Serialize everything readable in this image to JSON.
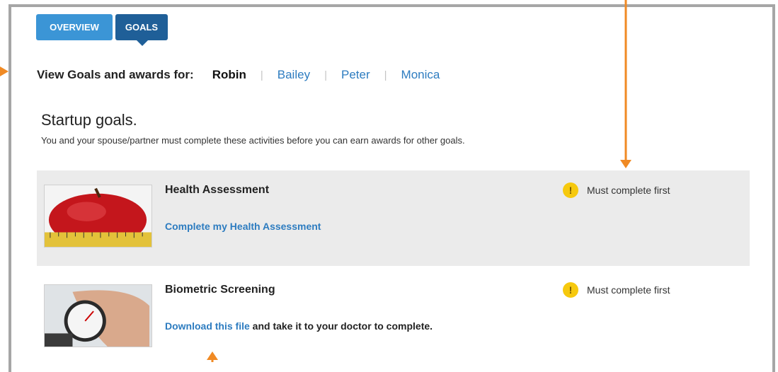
{
  "tabs": [
    {
      "label": "OVERVIEW",
      "active": false
    },
    {
      "label": "GOALS",
      "active": true
    }
  ],
  "view_goals": {
    "label": "View Goals and awards for:",
    "members": [
      "Robin",
      "Bailey",
      "Peter",
      "Monica"
    ],
    "selected": "Robin"
  },
  "section": {
    "title": "Startup goals.",
    "subtitle": "You and your spouse/partner must complete these activities before you can earn awards for other goals."
  },
  "goals": [
    {
      "title": "Health Assessment",
      "link": "Complete my Health Assessment",
      "status": "Must complete first",
      "image": "apple-tape-measure-photo"
    },
    {
      "title": "Biometric Screening",
      "link": "Download this file",
      "after_link": " and take it to your doctor to complete.",
      "status": "Must complete first",
      "image": "blood-pressure-gauge-photo"
    }
  ],
  "icons": {
    "status": "warning-icon",
    "callouts": "orange-arrow-icon"
  },
  "colors": {
    "tab_overview": "#3b95d6",
    "tab_goals": "#1f5f98",
    "link": "#2d7cc0",
    "row_shade": "#ebebeb",
    "warning": "#f6c90e",
    "callout_arrow": "#f08a24"
  }
}
